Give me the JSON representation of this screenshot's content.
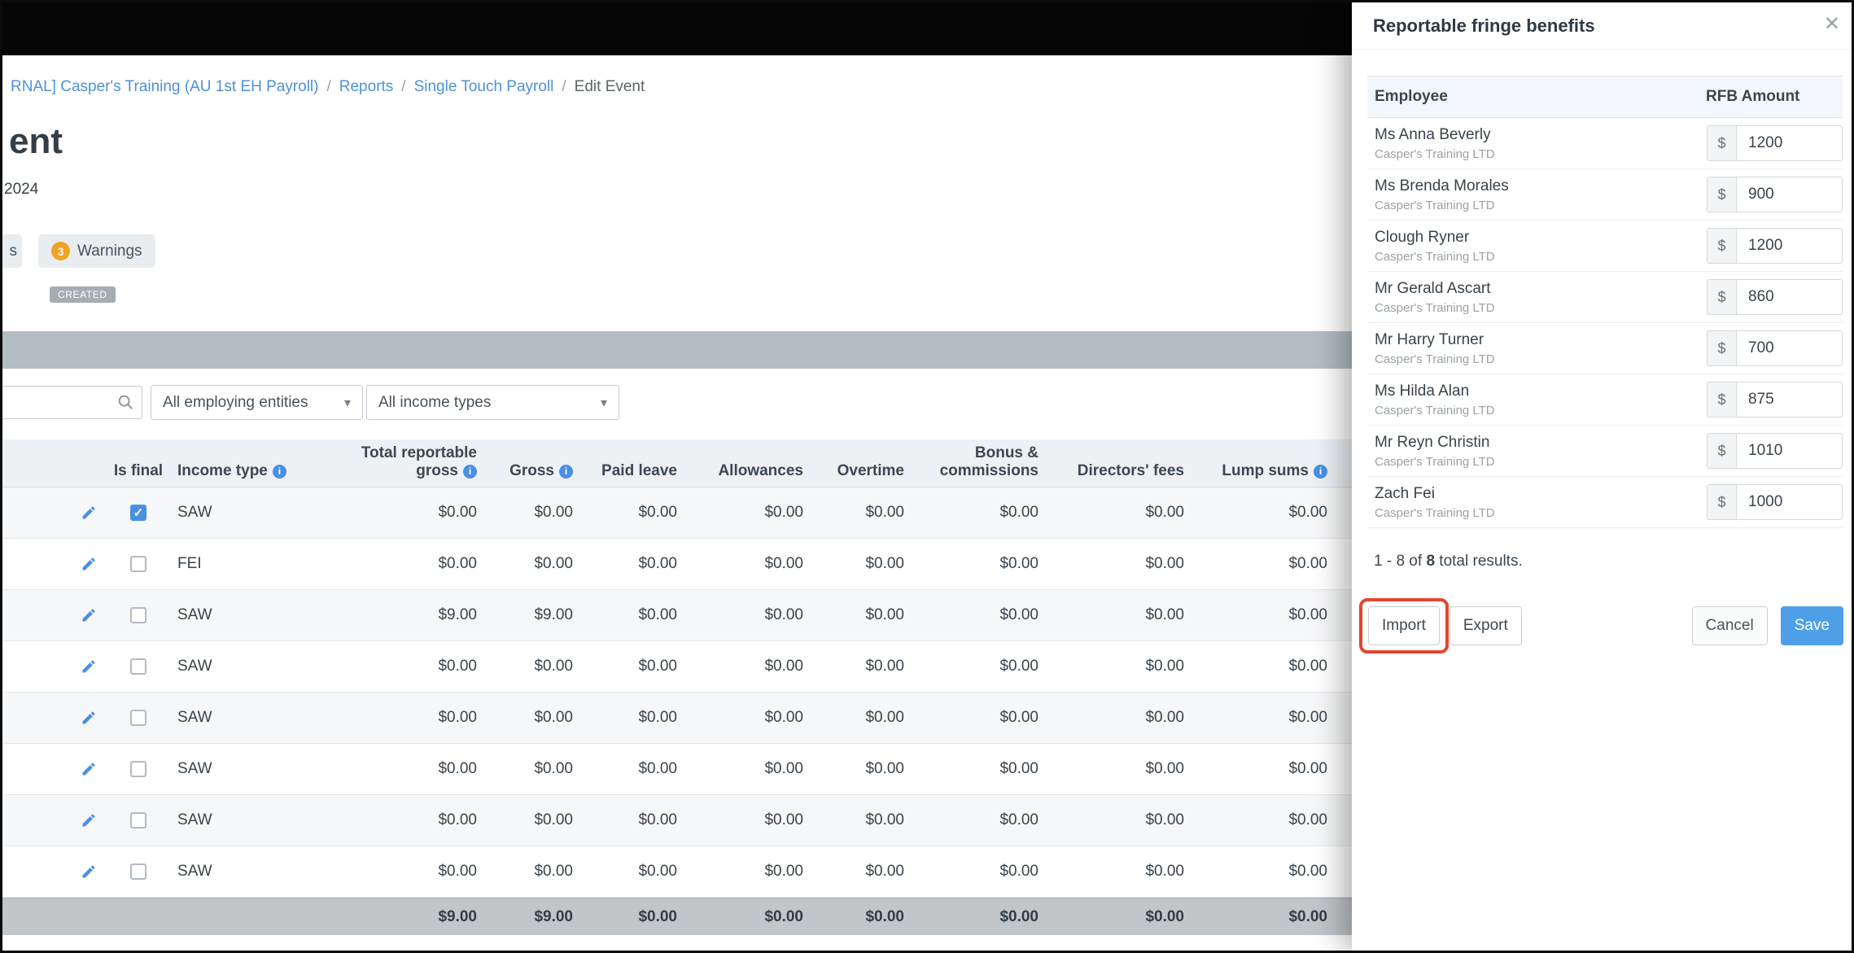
{
  "colors": {
    "accent_blue": "#4a90e2",
    "link_blue": "#4e91d4",
    "warning_orange": "#f0a325",
    "status_grey": "#a7acb1",
    "band_grey": "#b2bdc4",
    "save_blue": "#4f9fe8",
    "annotation_red": "#e1472e"
  },
  "icons": {
    "close": "✕",
    "caret": "▾",
    "info": "i"
  },
  "breadcrumb": {
    "link1": "RNAL] Casper's Training (AU 1st EH Payroll)",
    "link2": "Reports",
    "link3": "Single Touch Payroll",
    "current": "Edit Event",
    "separator": "/"
  },
  "header": {
    "title_partial": "ent",
    "subtitle_partial": "2024"
  },
  "tabs": {
    "partial_label": "s",
    "warnings_label": "Warnings",
    "warnings_count": "3"
  },
  "status": {
    "label": "CREATED"
  },
  "filters": {
    "entities": "All employing entities",
    "income_types": "All income types"
  },
  "stp_table": {
    "headers": {
      "is_final": "Is final",
      "income_type": "Income type",
      "total_reportable_gross": "Total reportable gross",
      "gross": "Gross",
      "paid_leave": "Paid leave",
      "allowances": "Allowances",
      "overtime": "Overtime",
      "bonus_commissions": "Bonus & commissions",
      "directors_fees": "Directors' fees",
      "lump_sums": "Lump sums"
    },
    "rows": [
      {
        "checked": true,
        "income_type": "SAW",
        "values": [
          "$0.00",
          "$0.00",
          "$0.00",
          "$0.00",
          "$0.00",
          "$0.00",
          "$0.00",
          "$0.00"
        ]
      },
      {
        "checked": false,
        "income_type": "FEI",
        "values": [
          "$0.00",
          "$0.00",
          "$0.00",
          "$0.00",
          "$0.00",
          "$0.00",
          "$0.00",
          "$0.00"
        ]
      },
      {
        "checked": false,
        "income_type": "SAW",
        "values": [
          "$9.00",
          "$9.00",
          "$0.00",
          "$0.00",
          "$0.00",
          "$0.00",
          "$0.00",
          "$0.00"
        ]
      },
      {
        "checked": false,
        "income_type": "SAW",
        "values": [
          "$0.00",
          "$0.00",
          "$0.00",
          "$0.00",
          "$0.00",
          "$0.00",
          "$0.00",
          "$0.00"
        ]
      },
      {
        "checked": false,
        "income_type": "SAW",
        "values": [
          "$0.00",
          "$0.00",
          "$0.00",
          "$0.00",
          "$0.00",
          "$0.00",
          "$0.00",
          "$0.00"
        ]
      },
      {
        "checked": false,
        "income_type": "SAW",
        "values": [
          "$0.00",
          "$0.00",
          "$0.00",
          "$0.00",
          "$0.00",
          "$0.00",
          "$0.00",
          "$0.00"
        ]
      },
      {
        "checked": false,
        "income_type": "SAW",
        "values": [
          "$0.00",
          "$0.00",
          "$0.00",
          "$0.00",
          "$0.00",
          "$0.00",
          "$0.00",
          "$0.00"
        ]
      },
      {
        "checked": false,
        "income_type": "SAW",
        "values": [
          "$0.00",
          "$0.00",
          "$0.00",
          "$0.00",
          "$0.00",
          "$0.00",
          "$0.00",
          "$0.00"
        ]
      }
    ],
    "totals": [
      "$9.00",
      "$9.00",
      "$0.00",
      "$0.00",
      "$0.00",
      "$0.00",
      "$0.00",
      "$0.00"
    ]
  },
  "modal": {
    "title": "Reportable fringe benefits",
    "currency": "$",
    "columns": {
      "employee": "Employee",
      "amount": "RFB Amount"
    },
    "rows": [
      {
        "name": "Ms Anna Beverly",
        "company": "Casper's Training LTD",
        "amount": "1200"
      },
      {
        "name": "Ms Brenda Morales",
        "company": "Casper's Training LTD",
        "amount": "900"
      },
      {
        "name": "Clough Ryner",
        "company": "Casper's Training LTD",
        "amount": "1200"
      },
      {
        "name": "Mr Gerald Ascart",
        "company": "Casper's Training LTD",
        "amount": "860"
      },
      {
        "name": "Mr Harry Turner",
        "company": "Casper's Training LTD",
        "amount": "700"
      },
      {
        "name": "Ms Hilda Alan",
        "company": "Casper's Training LTD",
        "amount": "875"
      },
      {
        "name": "Mr Reyn Christin",
        "company": "Casper's Training LTD",
        "amount": "1010"
      },
      {
        "name": "Zach Fei",
        "company": "Casper's Training LTD",
        "amount": "1000"
      }
    ],
    "results": {
      "prefix": "1 - 8 of",
      "count": "8",
      "suffix": "total results."
    },
    "buttons": {
      "import": "Import",
      "export": "Export",
      "cancel": "Cancel",
      "save": "Save"
    }
  }
}
